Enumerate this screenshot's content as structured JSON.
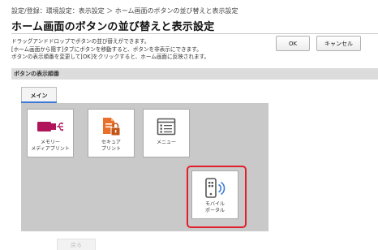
{
  "breadcrumb": "設定/登録：環境設定：表示設定 ＞ ホーム画面のボタンの並び替えと表示設定",
  "title": "ホーム画面のボタンの並び替えと表示設定",
  "description": [
    "ドラッグアンドドロップでボタンの並び替えができます。",
    "[ホーム画面から隠す]タブにボタンを移動すると、ボタンを非表示にできます。",
    "ボタンの表示順番を変更して[OK]をクリックすると、ホーム画面に反映されます。"
  ],
  "buttons": {
    "ok": "OK",
    "cancel": "キャンセル"
  },
  "section": {
    "title": "ボタンの表示順番"
  },
  "tabs": [
    {
      "label": "メイン",
      "active": true
    }
  ],
  "tiles": [
    {
      "label_line1": "メモリー",
      "label_line2": "メディアプリント",
      "icon": "usb-memory-icon"
    },
    {
      "label_line1": "セキュア",
      "label_line2": "プリント",
      "icon": "secure-print-icon"
    },
    {
      "label_line1": "メニュー",
      "label_line2": "",
      "icon": "menu-list-icon"
    },
    {
      "label_line1": "モバイル",
      "label_line2": "ポータル",
      "icon": "mobile-portal-icon"
    }
  ],
  "footer": {
    "button": "戻る"
  },
  "colors": {
    "accent": "#3b78d8",
    "highlight": "#e0202a",
    "icon_magenta": "#b0155b",
    "icon_orange": "#e8702a",
    "icon_blue": "#3a7bd5"
  }
}
